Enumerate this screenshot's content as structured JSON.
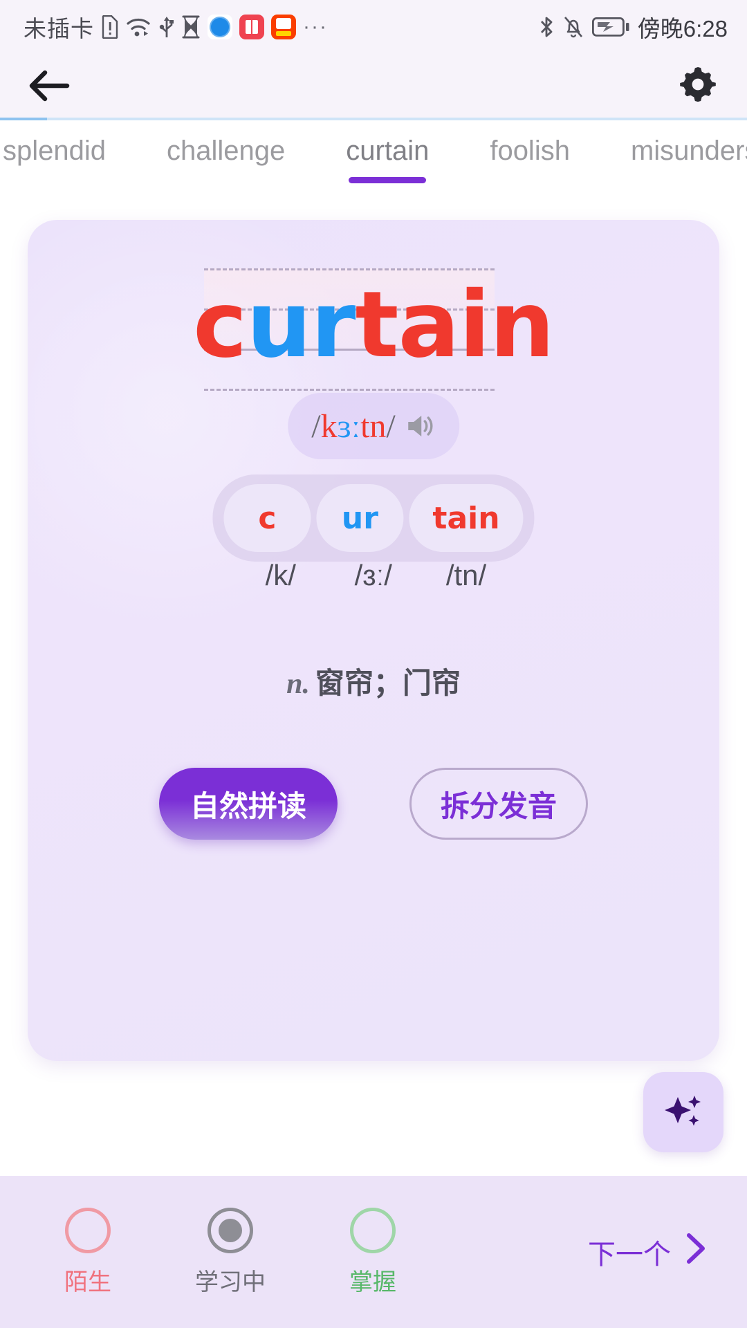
{
  "status_bar": {
    "carrier": "未插卡",
    "time": "傍晚6:28",
    "left_icons": [
      "sim-alert-icon",
      "wifi-icon",
      "usb-icon",
      "hourglass-icon",
      "app-globe-icon",
      "app-book-icon",
      "app-kuaishou-icon",
      "more-dots-icon"
    ],
    "right_icons": [
      "bluetooth-icon",
      "bell-muted-icon",
      "battery-charging-icon"
    ],
    "more": "···"
  },
  "header": {
    "back_icon": "arrow-left-icon",
    "settings_icon": "gear-icon"
  },
  "tabs": {
    "items": [
      {
        "label": "splendid",
        "active": false
      },
      {
        "label": "challenge",
        "active": false
      },
      {
        "label": "curtain",
        "active": true
      },
      {
        "label": "foolish",
        "active": false
      },
      {
        "label": "misunderstand",
        "active": false
      }
    ],
    "active_index": 2,
    "indicator_color": "#7b2fd6"
  },
  "card": {
    "word": {
      "full": "curtain",
      "parts": [
        {
          "text": "c",
          "color": "#f0392e"
        },
        {
          "text": "ur",
          "color": "#2196f3"
        },
        {
          "text": "tain",
          "color": "#f0392e"
        }
      ]
    },
    "phonetic": {
      "open_slash": "/",
      "close_slash": "/",
      "parts": [
        {
          "text": "k",
          "color": "#f0392e"
        },
        {
          "text": "ɜː",
          "color": "#2196f3"
        },
        {
          "text": "tn",
          "color": "#f0392e"
        }
      ],
      "speaker_icon": "speaker-icon"
    },
    "syllables": [
      {
        "letters": "c",
        "phoneme": "/k/",
        "color": "#f0392e"
      },
      {
        "letters": "ur",
        "phoneme": "/ɜː/",
        "color": "#2196f3"
      },
      {
        "letters": "tain",
        "phoneme": "/tn/",
        "color": "#f0392e"
      }
    ],
    "definition": {
      "pos": "n.",
      "meaning": "窗帘；门帘"
    },
    "buttons": {
      "primary": "自然拼读",
      "secondary": "拆分发音"
    }
  },
  "fab": {
    "icon": "sparkles-icon"
  },
  "bottom_bar": {
    "marks": [
      {
        "label": "陌生",
        "state": "unknown",
        "color": "#f0727e",
        "selected": false
      },
      {
        "label": "学习中",
        "state": "learning",
        "color": "#6f6f78",
        "selected": true
      },
      {
        "label": "掌握",
        "state": "mastered",
        "color": "#58b86a",
        "selected": false
      }
    ],
    "next_label": "下一个",
    "next_icon": "chevron-right-icon"
  }
}
